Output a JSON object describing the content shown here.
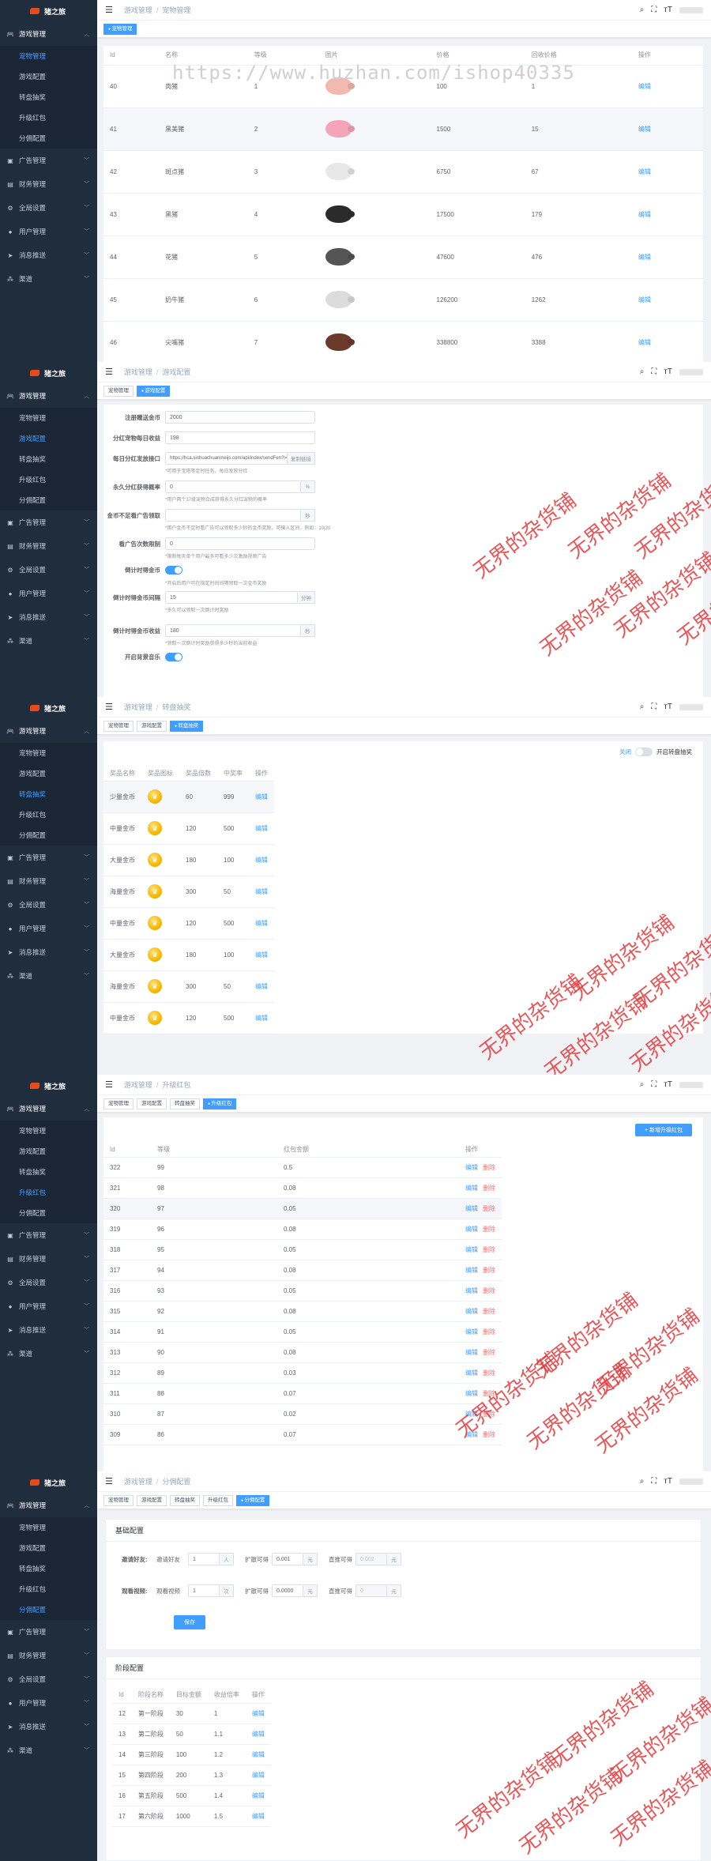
{
  "brand": "猪之旅",
  "menu": {
    "game": "游戏管理",
    "pets": "宠物管理",
    "config": "游戏配置",
    "lottery": "转盘抽奖",
    "redpack": "升级红包",
    "split": "分佣配置",
    "ad": "广告管理",
    "finance": "财务管理",
    "global": "全局设置",
    "user": "用户管理",
    "msg": "消息推送",
    "channel": "渠道"
  },
  "nav": {
    "game": "游戏管理",
    "sep": "/"
  },
  "watermark": {
    "url": "https://www.huzhan.com/ishop40335",
    "shop": "无界的杂货铺"
  },
  "s1": {
    "crumb": "宠物管理",
    "tag": "宠物管理",
    "headers": [
      "Id",
      "名称",
      "等级",
      "图片",
      "价格",
      "回收价格",
      "操作"
    ],
    "rows": [
      {
        "id": "40",
        "name": "肉猪",
        "level": "1",
        "color": "#f2b9b0",
        "price": "100",
        "recycle": "1",
        "op": "编辑"
      },
      {
        "id": "41",
        "name": "黑美猪",
        "level": "2",
        "color": "#f4a6b8",
        "price": "1500",
        "recycle": "15",
        "op": "编辑"
      },
      {
        "id": "42",
        "name": "斑点猪",
        "level": "3",
        "color": "#e8e8e8",
        "price": "6750",
        "recycle": "67",
        "op": "编辑"
      },
      {
        "id": "43",
        "name": "黑猪",
        "level": "4",
        "color": "#2b2b2b",
        "price": "17500",
        "recycle": "179",
        "op": "编辑"
      },
      {
        "id": "44",
        "name": "花猪",
        "level": "5",
        "color": "#555555",
        "price": "47600",
        "recycle": "476",
        "op": "编辑"
      },
      {
        "id": "45",
        "name": "奶牛猪",
        "level": "6",
        "color": "#dcdcdc",
        "price": "126200",
        "recycle": "1262",
        "op": "编辑"
      },
      {
        "id": "46",
        "name": "尖嘴猪",
        "level": "7",
        "color": "#6b3a2a",
        "price": "338800",
        "recycle": "3388",
        "op": "编辑"
      }
    ]
  },
  "s2": {
    "crumb": "游戏配置",
    "tags": [
      "宠物管理",
      "游戏配置"
    ],
    "fields": {
      "reg_label": "注册赠送金币",
      "reg_val": "2000",
      "share_label": "分红宠物每日收益",
      "share_val": "198",
      "api_label": "每日分红发放接口",
      "api_val": "https://hca.sinhuachuanmeijs.com/api/index/sendFen?i=2&",
      "api_btn": "复制链接",
      "api_hint": "*可用于宝塔等定时任务，每日发放分红",
      "perm_label": "永久分红获得概率",
      "perm_val": "0",
      "perm_unit": "%",
      "perm_hint": "*用户两个37级宠物合成获得永久分红宠物的概率",
      "short_label": "金币不足看广告领取",
      "short_unit": "秒",
      "short_hint": "*用户金币不足时看广告可以领取多少秒的金币奖励，可输入区间，例如：10|20",
      "ad_label": "看广告次数限制",
      "ad_val": "0",
      "ad_hint": "*限制每天单个用户最多可看多少次激励视频广告",
      "timer_label": "倒计时得金币",
      "timer_hint": "*开启后用户可在指定时间间隔领取一次金币奖励",
      "interval_label": "倒计时得金币间隔",
      "interval_val": "15",
      "interval_unit": "分钟",
      "interval_hint": "*多久可以领取一次倒计时奖励",
      "income_label": "倒计时得金币收益",
      "income_val": "180",
      "income_unit": "秒",
      "income_hint": "*领取一次倒计时奖励获得多少秒的当前收益",
      "music_label": "开启背景音乐"
    }
  },
  "s3": {
    "crumb": "转盘抽奖",
    "tags": [
      "宠物管理",
      "游戏配置",
      "转盘抽奖"
    ],
    "toggle_off": "关闭",
    "toggle_label": "开启转盘抽奖",
    "headers": [
      "奖品名称",
      "奖品图标",
      "奖品倍数",
      "中奖率",
      "操作"
    ],
    "rows": [
      {
        "name": "少量金币",
        "mult": "60",
        "rate": "999",
        "op": "编辑"
      },
      {
        "name": "中量金币",
        "mult": "120",
        "rate": "500",
        "op": "编辑"
      },
      {
        "name": "大量金币",
        "mult": "180",
        "rate": "100",
        "op": "编辑"
      },
      {
        "name": "海量金币",
        "mult": "300",
        "rate": "50",
        "op": "编辑"
      },
      {
        "name": "中量金币",
        "mult": "120",
        "rate": "500",
        "op": "编辑"
      },
      {
        "name": "大量金币",
        "mult": "180",
        "rate": "100",
        "op": "编辑"
      },
      {
        "name": "海量金币",
        "mult": "300",
        "rate": "50",
        "op": "编辑"
      },
      {
        "name": "中量金币",
        "mult": "120",
        "rate": "500",
        "op": "编辑"
      }
    ]
  },
  "s4": {
    "crumb": "升级红包",
    "tags": [
      "宠物管理",
      "游戏配置",
      "转盘抽奖",
      "升级红包"
    ],
    "add_btn": "+ 新增升级红包",
    "headers": [
      "Id",
      "等级",
      "红包金额",
      "操作"
    ],
    "edit": "编辑",
    "delete": "删除",
    "rows": [
      {
        "id": "322",
        "lv": "99",
        "amt": "0.5"
      },
      {
        "id": "321",
        "lv": "98",
        "amt": "0.08"
      },
      {
        "id": "320",
        "lv": "97",
        "amt": "0.05"
      },
      {
        "id": "319",
        "lv": "96",
        "amt": "0.08"
      },
      {
        "id": "318",
        "lv": "95",
        "amt": "0.05"
      },
      {
        "id": "317",
        "lv": "94",
        "amt": "0.08"
      },
      {
        "id": "316",
        "lv": "93",
        "amt": "0.05"
      },
      {
        "id": "315",
        "lv": "92",
        "amt": "0.08"
      },
      {
        "id": "314",
        "lv": "91",
        "amt": "0.05"
      },
      {
        "id": "313",
        "lv": "90",
        "amt": "0.08"
      },
      {
        "id": "312",
        "lv": "89",
        "amt": "0.03"
      },
      {
        "id": "311",
        "lv": "88",
        "amt": "0.07"
      },
      {
        "id": "310",
        "lv": "87",
        "amt": "0.02"
      },
      {
        "id": "309",
        "lv": "86",
        "amt": "0.07"
      }
    ]
  },
  "s5": {
    "crumb": "分佣配置",
    "tags": [
      "宠物管理",
      "游戏配置",
      "转盘抽奖",
      "升级红包",
      "分佣配置"
    ],
    "basic_title": "基础配置",
    "r1_label": "邀请好友:",
    "r1_sub": "邀请好友",
    "r1_val": "1",
    "r1_unit": "人",
    "r1_k": "扩散可得",
    "r1_kv": "0.001",
    "r1_ku": "元",
    "r1_d": "直推可得",
    "r1_dv": "0.002",
    "r1_du": "元",
    "r2_label": "观看视频:",
    "r2_sub": "观看视频",
    "r2_val": "1",
    "r2_unit": "次",
    "r2_k": "扩散可得",
    "r2_kv": "0.0000",
    "r2_ku": "元",
    "r2_d": "直推可得",
    "r2_dv": "0",
    "r2_du": "元",
    "save": "保存",
    "stage_title": "阶段配置",
    "headers": [
      "Id",
      "阶段名称",
      "目标金额",
      "收益倍率",
      "操作"
    ],
    "rows": [
      {
        "id": "12",
        "name": "第一阶段",
        "target": "30",
        "rate": "1",
        "op": "编辑"
      },
      {
        "id": "13",
        "name": "第二阶段",
        "target": "50",
        "rate": "1.1",
        "op": "编辑"
      },
      {
        "id": "14",
        "name": "第三阶段",
        "target": "100",
        "rate": "1.2",
        "op": "编辑"
      },
      {
        "id": "15",
        "name": "第四阶段",
        "target": "200",
        "rate": "1.3",
        "op": "编辑"
      },
      {
        "id": "16",
        "name": "第五阶段",
        "target": "500",
        "rate": "1.4",
        "op": "编辑"
      },
      {
        "id": "17",
        "name": "第六阶段",
        "target": "1000",
        "rate": "1.5",
        "op": "编辑"
      }
    ]
  }
}
